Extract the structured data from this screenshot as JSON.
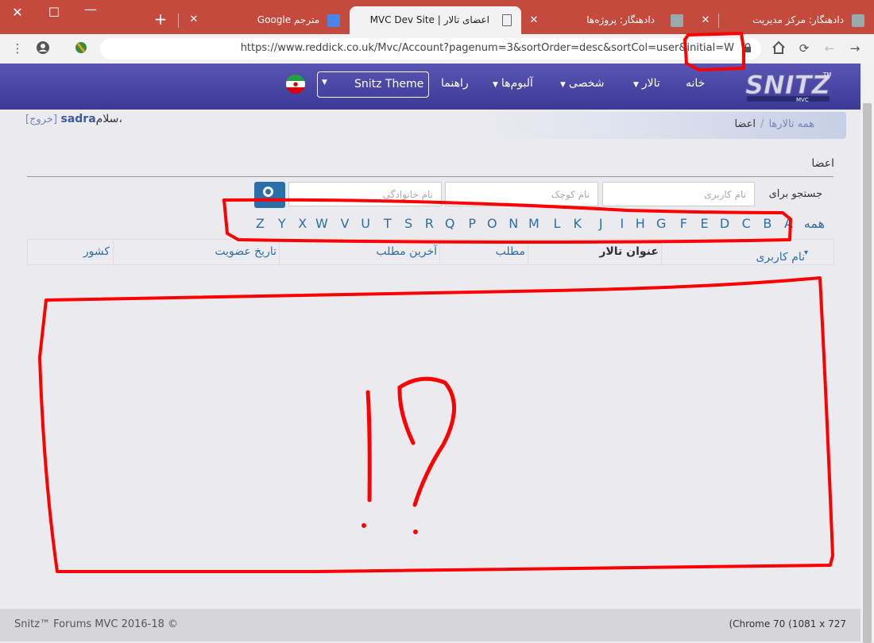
{
  "browser": {
    "tabs": [
      {
        "title": "دادهنگار: مرکز مدیریت",
        "active": false
      },
      {
        "title": "دادهنگار: پروژه‌ها",
        "active": false
      },
      {
        "title": "اعضای تالار | MVC Dev Site",
        "active": true
      },
      {
        "title": "مترجم Google",
        "active": false
      }
    ],
    "new_tab": "+",
    "url": "https://www.reddick.co.uk/Mvc/Account?pagenum=3&sortOrder=desc&sortCol=user&initial=W"
  },
  "site": {
    "logo_text": "SNITZ",
    "logo_sub": "MVC",
    "logo_tm": "TM",
    "nav": [
      {
        "label": "خانه",
        "caret": false
      },
      {
        "label": "تالار",
        "caret": true
      },
      {
        "label": "شخصی",
        "caret": true
      },
      {
        "label": "آلبوم‌ها",
        "caret": true
      },
      {
        "label": "راهنما",
        "caret": false
      }
    ],
    "theme": "Snitz Theme"
  },
  "breadcrumb": {
    "home": "همه تالارها",
    "sep": "/",
    "current": "اعضا"
  },
  "greeting": {
    "logout": "[خروج]",
    "username": "sadra",
    "hello": "سلام،"
  },
  "page": {
    "title": "اعضا",
    "search_label": "جستجو برای",
    "placeholders": {
      "username": "نام کاربری",
      "firstname": "نام کوچک",
      "lastname": "نام خانوادگی"
    }
  },
  "alphabet": {
    "all": "همه",
    "letters": [
      "A",
      "B",
      "C",
      "D",
      "E",
      "F",
      "G",
      "H",
      "I",
      "J",
      "K",
      "L",
      "M",
      "N",
      "O",
      "P",
      "Q",
      "R",
      "S",
      "T",
      "U",
      "V",
      "W",
      "X",
      "Y",
      "Z"
    ]
  },
  "table": {
    "headers": [
      {
        "label": "نام کاربری",
        "sort": "▾",
        "bold": false
      },
      {
        "label": "عنوان تالار",
        "bold": true
      },
      {
        "label": "مطلب",
        "bold": false
      },
      {
        "label": "آخرین مطلب",
        "bold": false
      },
      {
        "label": "تاریخ عضویت",
        "bold": false
      },
      {
        "label": "کشور",
        "bold": false
      }
    ]
  },
  "annotation": {
    "text": "!?"
  },
  "footer": {
    "left": "Snitz™ Forums MVC 2016-18 ©",
    "right": "(Chrome 70 (1081 x 727"
  },
  "colors": {
    "accent": "#2c6ea8",
    "header": "#3b3a96",
    "tabstrip": "#c34a3c",
    "marker": "#ff0000"
  }
}
